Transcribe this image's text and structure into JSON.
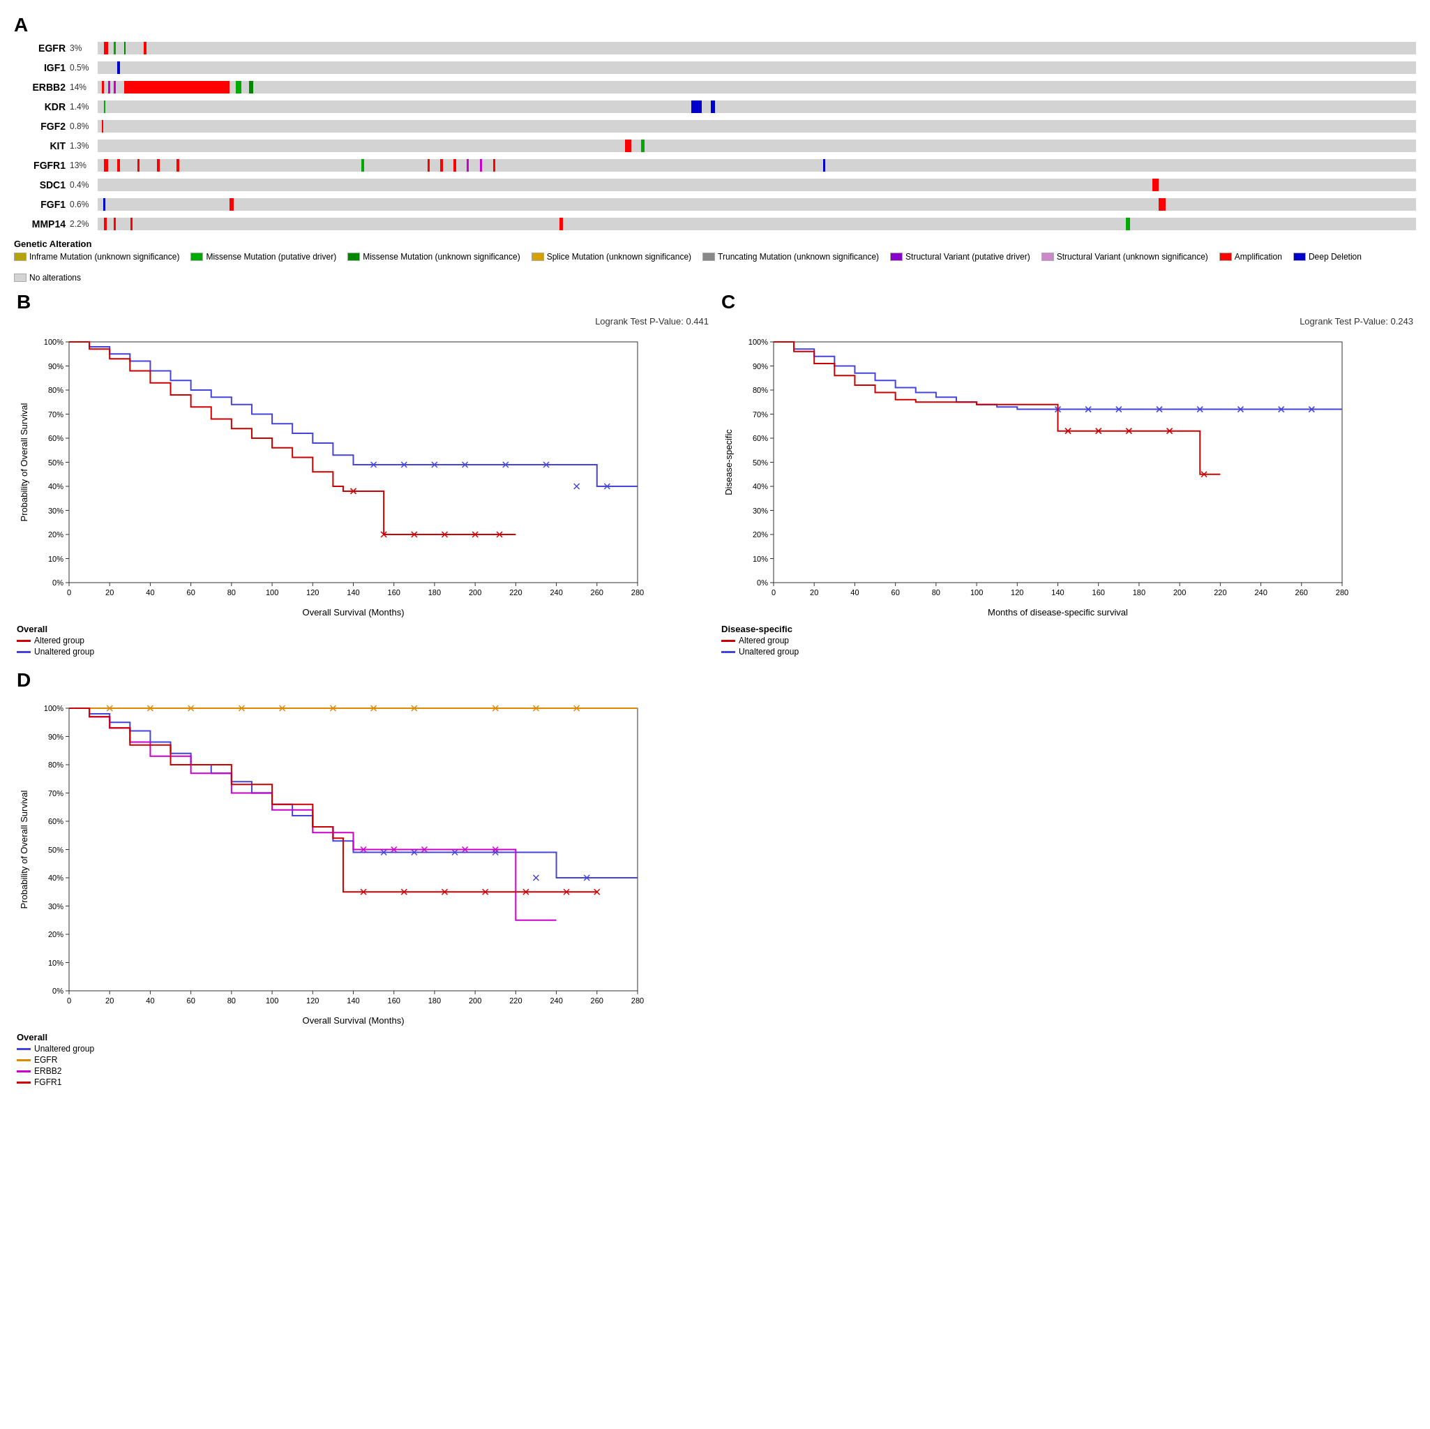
{
  "panel_a": {
    "label": "A",
    "genes": [
      {
        "name": "EGFR",
        "pct": "3%",
        "bars": [
          {
            "left": 0.5,
            "width": 0.3,
            "color": "#ff0000"
          },
          {
            "left": 1.2,
            "width": 0.15,
            "color": "#00aa00"
          },
          {
            "left": 2.0,
            "width": 0.1,
            "color": "#008800"
          },
          {
            "left": 3.5,
            "width": 0.2,
            "color": "#ff0000"
          }
        ]
      },
      {
        "name": "IGF1",
        "pct": "0.5%",
        "bars": [
          {
            "left": 1.5,
            "width": 0.2,
            "color": "#0000cc"
          }
        ]
      },
      {
        "name": "ERBB2",
        "pct": "14%",
        "bars": [
          {
            "left": 0.3,
            "width": 0.2,
            "color": "#ff0000"
          },
          {
            "left": 0.8,
            "width": 0.15,
            "color": "#cc00cc"
          },
          {
            "left": 1.2,
            "width": 0.15,
            "color": "#cc00cc"
          },
          {
            "left": 2.0,
            "width": 8.0,
            "color": "#ff0000"
          },
          {
            "left": 10.5,
            "width": 0.4,
            "color": "#00aa00"
          },
          {
            "left": 11.5,
            "width": 0.3,
            "color": "#008800"
          }
        ]
      },
      {
        "name": "KDR",
        "pct": "1.4%",
        "bars": [
          {
            "left": 0.5,
            "width": 0.1,
            "color": "#00aa00"
          },
          {
            "left": 45.0,
            "width": 0.8,
            "color": "#0000cc"
          },
          {
            "left": 46.5,
            "width": 0.3,
            "color": "#0000cc"
          }
        ]
      },
      {
        "name": "FGF2",
        "pct": "0.8%",
        "bars": [
          {
            "left": 0.3,
            "width": 0.1,
            "color": "#ff0000"
          }
        ]
      },
      {
        "name": "KIT",
        "pct": "1.3%",
        "bars": [
          {
            "left": 40.0,
            "width": 0.5,
            "color": "#ff0000"
          },
          {
            "left": 41.2,
            "width": 0.3,
            "color": "#00aa00"
          }
        ]
      },
      {
        "name": "FGFR1",
        "pct": "13%",
        "bars": [
          {
            "left": 0.5,
            "width": 0.3,
            "color": "#ff0000"
          },
          {
            "left": 1.5,
            "width": 0.2,
            "color": "#ff0000"
          },
          {
            "left": 3.0,
            "width": 0.2,
            "color": "#ff0000"
          },
          {
            "left": 4.5,
            "width": 0.2,
            "color": "#ff0000"
          },
          {
            "left": 6.0,
            "width": 0.2,
            "color": "#ff0000"
          },
          {
            "left": 20.0,
            "width": 0.2,
            "color": "#00aa00"
          },
          {
            "left": 25.0,
            "width": 0.2,
            "color": "#ff0000"
          },
          {
            "left": 26.0,
            "width": 0.2,
            "color": "#ff0000"
          },
          {
            "left": 27.0,
            "width": 0.2,
            "color": "#ff0000"
          },
          {
            "left": 28.0,
            "width": 0.15,
            "color": "#cc00cc"
          },
          {
            "left": 29.0,
            "width": 0.15,
            "color": "#cc00cc"
          },
          {
            "left": 30.0,
            "width": 0.15,
            "color": "#ff0000"
          },
          {
            "left": 55.0,
            "width": 0.2,
            "color": "#0000cc"
          }
        ]
      },
      {
        "name": "SDC1",
        "pct": "0.4%",
        "bars": [
          {
            "left": 80.0,
            "width": 0.5,
            "color": "#ff0000"
          }
        ]
      },
      {
        "name": "FGF1",
        "pct": "0.6%",
        "bars": [
          {
            "left": 0.4,
            "width": 0.2,
            "color": "#0000cc"
          },
          {
            "left": 10.0,
            "width": 0.3,
            "color": "#ff0000"
          },
          {
            "left": 80.5,
            "width": 0.5,
            "color": "#ff0000"
          }
        ]
      },
      {
        "name": "MMP14",
        "pct": "2.2%",
        "bars": [
          {
            "left": 0.5,
            "width": 0.2,
            "color": "#ff0000"
          },
          {
            "left": 1.2,
            "width": 0.15,
            "color": "#ff0000"
          },
          {
            "left": 2.5,
            "width": 0.15,
            "color": "#ff0000"
          },
          {
            "left": 35.0,
            "width": 0.3,
            "color": "#ff0000"
          },
          {
            "left": 78.0,
            "width": 0.3,
            "color": "#00aa00"
          }
        ]
      }
    ],
    "legend": {
      "items": [
        {
          "label": "Inframe Mutation (unknown significance)",
          "color": "#b5a300",
          "type": "rect"
        },
        {
          "label": "Missense Mutation (putative driver)",
          "color": "#00aa00",
          "type": "rect"
        },
        {
          "label": "Missense Mutation (unknown significance)",
          "color": "#008800",
          "type": "rect"
        },
        {
          "label": "Splice Mutation (unknown significance)",
          "color": "#d4a200",
          "type": "rect"
        },
        {
          "label": "Truncating Mutation (unknown significance)",
          "color": "#888888",
          "type": "rect"
        },
        {
          "label": "Structural Variant (putative driver)",
          "color": "#8800cc",
          "type": "rect"
        },
        {
          "label": "Structural Variant (unknown significance)",
          "color": "#cc88cc",
          "type": "rect"
        },
        {
          "label": "Amplification",
          "color": "#ff0000",
          "type": "rect"
        },
        {
          "label": "Deep Deletion",
          "color": "#0000cc",
          "type": "rect"
        },
        {
          "label": "No alterations",
          "color": "#d3d3d3",
          "type": "rect"
        }
      ]
    }
  },
  "panel_b": {
    "label": "B",
    "pvalue": "Logrank Test P-Value: 0.441",
    "x_label": "Overall Survival (Months)",
    "y_label": "Probability of Overall Survival",
    "legend_title": "Overall",
    "legend_items": [
      {
        "label": "Altered group",
        "color": "#cc0000"
      },
      {
        "label": "Unaltered group",
        "color": "#4444dd"
      }
    ]
  },
  "panel_c": {
    "label": "C",
    "pvalue": "Logrank Test P-Value: 0.243",
    "x_label": "Months of disease-specific survival",
    "y_label": "Disease-specific",
    "legend_title": "Disease-specific",
    "legend_items": [
      {
        "label": "Altered group",
        "color": "#cc0000"
      },
      {
        "label": "Unaltered group",
        "color": "#4444dd"
      }
    ]
  },
  "panel_d": {
    "label": "D",
    "x_label": "Overall Survival (Months)",
    "y_label": "Probability of Overall Survival",
    "legend_title": "Overall",
    "legend_items": [
      {
        "label": "Unaltered group",
        "color": "#4444dd"
      },
      {
        "label": "EGFR",
        "color": "#dd8800"
      },
      {
        "label": "ERBB2",
        "color": "#cc00cc"
      },
      {
        "label": "FGFR1",
        "color": "#cc0000"
      }
    ]
  },
  "genetic_alteration_label": "Genetic Alteration"
}
